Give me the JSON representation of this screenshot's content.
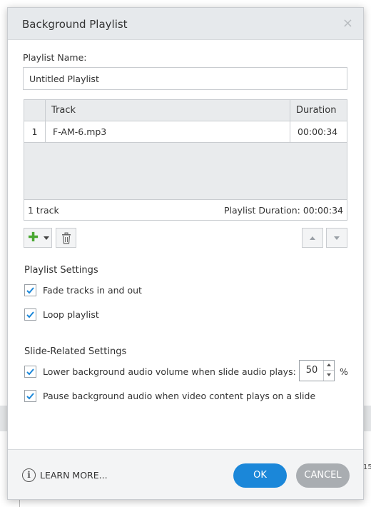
{
  "dialog": {
    "title": "Background Playlist",
    "close_glyph": "×"
  },
  "playlist": {
    "name_label": "Playlist Name:",
    "name_value": "Untitled Playlist"
  },
  "table": {
    "headers": {
      "num": "",
      "track": "Track",
      "duration": "Duration"
    },
    "rows": [
      {
        "num": "1",
        "track": "F-AM-6.mp3",
        "duration": "00:00:34"
      }
    ],
    "track_count": "1 track",
    "playlist_duration": "Playlist Duration: 00:00:34"
  },
  "toolbar": {
    "add_icon": "plus-icon",
    "delete_icon": "trash-icon",
    "move_up_icon": "arrow-up-icon",
    "move_down_icon": "arrow-down-icon"
  },
  "playlist_settings": {
    "title": "Playlist Settings",
    "fade_label": "Fade tracks in and out",
    "fade_checked": true,
    "loop_label": "Loop playlist",
    "loop_checked": true
  },
  "slide_settings": {
    "title": "Slide-Related Settings",
    "lower_volume_label": "Lower background audio volume when slide audio plays:",
    "lower_volume_checked": true,
    "volume_value": "50",
    "volume_unit": "%",
    "pause_label": "Pause background audio when video content plays on a slide",
    "pause_checked": true
  },
  "footer": {
    "info_glyph": "i",
    "learn_more": "LEARN MORE...",
    "ok": "OK",
    "cancel": "CANCEL"
  },
  "background": {
    "partial_number": "15"
  },
  "colors": {
    "primary": "#1b87d9",
    "cancel": "#a9adb1",
    "check": "#1b87d9",
    "add_green": "#4aa832"
  }
}
